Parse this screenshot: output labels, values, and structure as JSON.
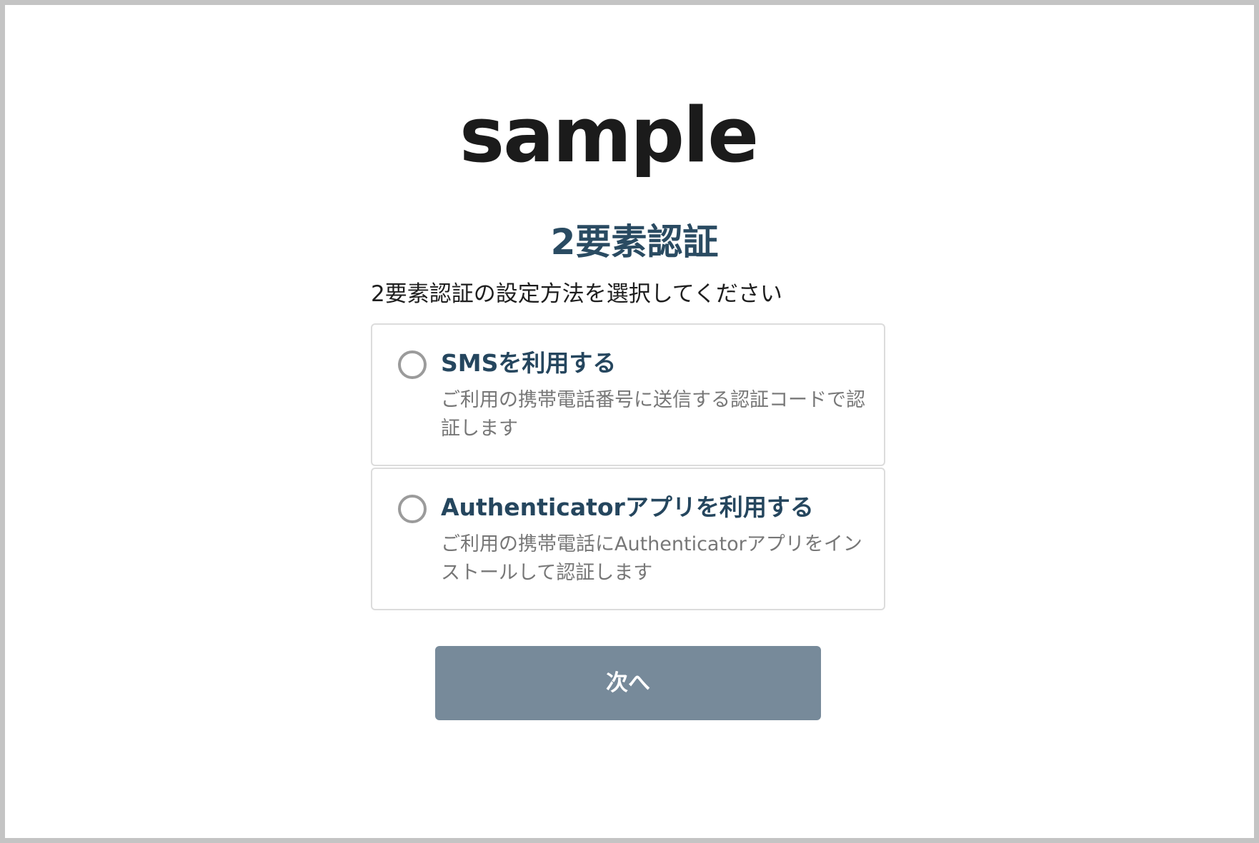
{
  "logo": {
    "text": "sample"
  },
  "page": {
    "title": "2要素認証",
    "instruction": "2要素認証の設定方法を選択してください"
  },
  "options": [
    {
      "title": "SMSを利用する",
      "description": "ご利用の携帯電話番号に送信する認証コードで認証します",
      "selected": false
    },
    {
      "title": "Authenticatorアプリを利用する",
      "description": "ご利用の携帯電話にAuthenticatorアプリをインストールして認証します",
      "selected": false
    }
  ],
  "actions": {
    "next_label": "次へ"
  },
  "colors": {
    "title": "#2a4b62",
    "option_title": "#25465e",
    "button_bg": "#778a9a",
    "border": "#dcdcdc",
    "frame": "#c4c4c4"
  }
}
